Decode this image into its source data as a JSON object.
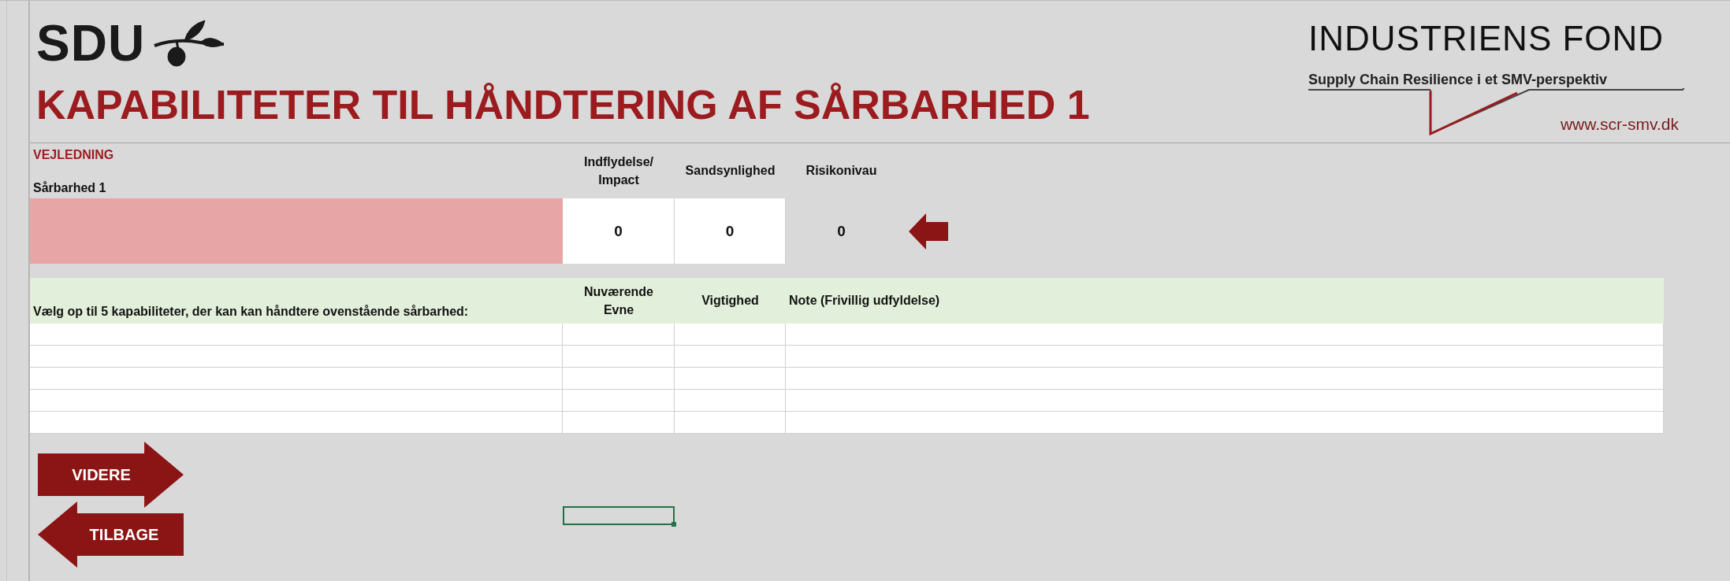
{
  "header": {
    "left_logo": "SDU",
    "right_logo": "INDUSTRIENS FOND",
    "tagline": "Supply Chain Resilience i et SMV-perspektiv",
    "url": "www.scr-smv.dk"
  },
  "title": "KAPABILITETER TIL HÅNDTERING AF SÅRBARHED 1",
  "guide_link": "VEJLEDNING",
  "vulnerability": {
    "label": "Sårbarhed 1",
    "columns": [
      "Indflydelse/ Impact",
      "Sandsynlighed",
      "Risikonivau"
    ],
    "values": [
      "0",
      "0",
      "0"
    ]
  },
  "capabilities": {
    "prompt": "Vælg op til 5 kapabiliteter, der kan kan håndtere ovenstående sårbarhed:",
    "columns": [
      "Nuværende Evne",
      "Vigtighed",
      "Note (Frivillig udfyldelse)"
    ]
  },
  "buttons": [
    {
      "label": "VIDERE",
      "kind": "forward"
    },
    {
      "label": "TILBAGE",
      "kind": "back"
    }
  ]
}
